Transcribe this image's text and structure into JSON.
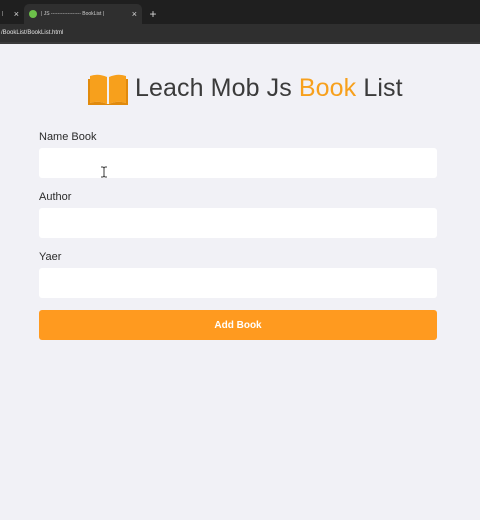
{
  "browser": {
    "tabs": [
      {
        "title": "|"
      },
      {
        "title": "| JS ------------------ BookList |"
      }
    ],
    "new_tab_symbol": "+",
    "close_symbol": "×",
    "url": "/BookList/BookList.html"
  },
  "page": {
    "icon": "open-book-icon",
    "title_prefix": "Leach Mob Js ",
    "title_accent": "Book",
    "title_suffix": " List",
    "accent_color": "#f7a01c",
    "background_color": "#f1f1f6"
  },
  "form": {
    "name_label": "Name Book",
    "name_value": "",
    "author_label": "Author",
    "author_value": "",
    "year_label": "Yaer",
    "year_value": "",
    "submit_label": "Add Book",
    "submit_color": "#ff9a1f"
  }
}
